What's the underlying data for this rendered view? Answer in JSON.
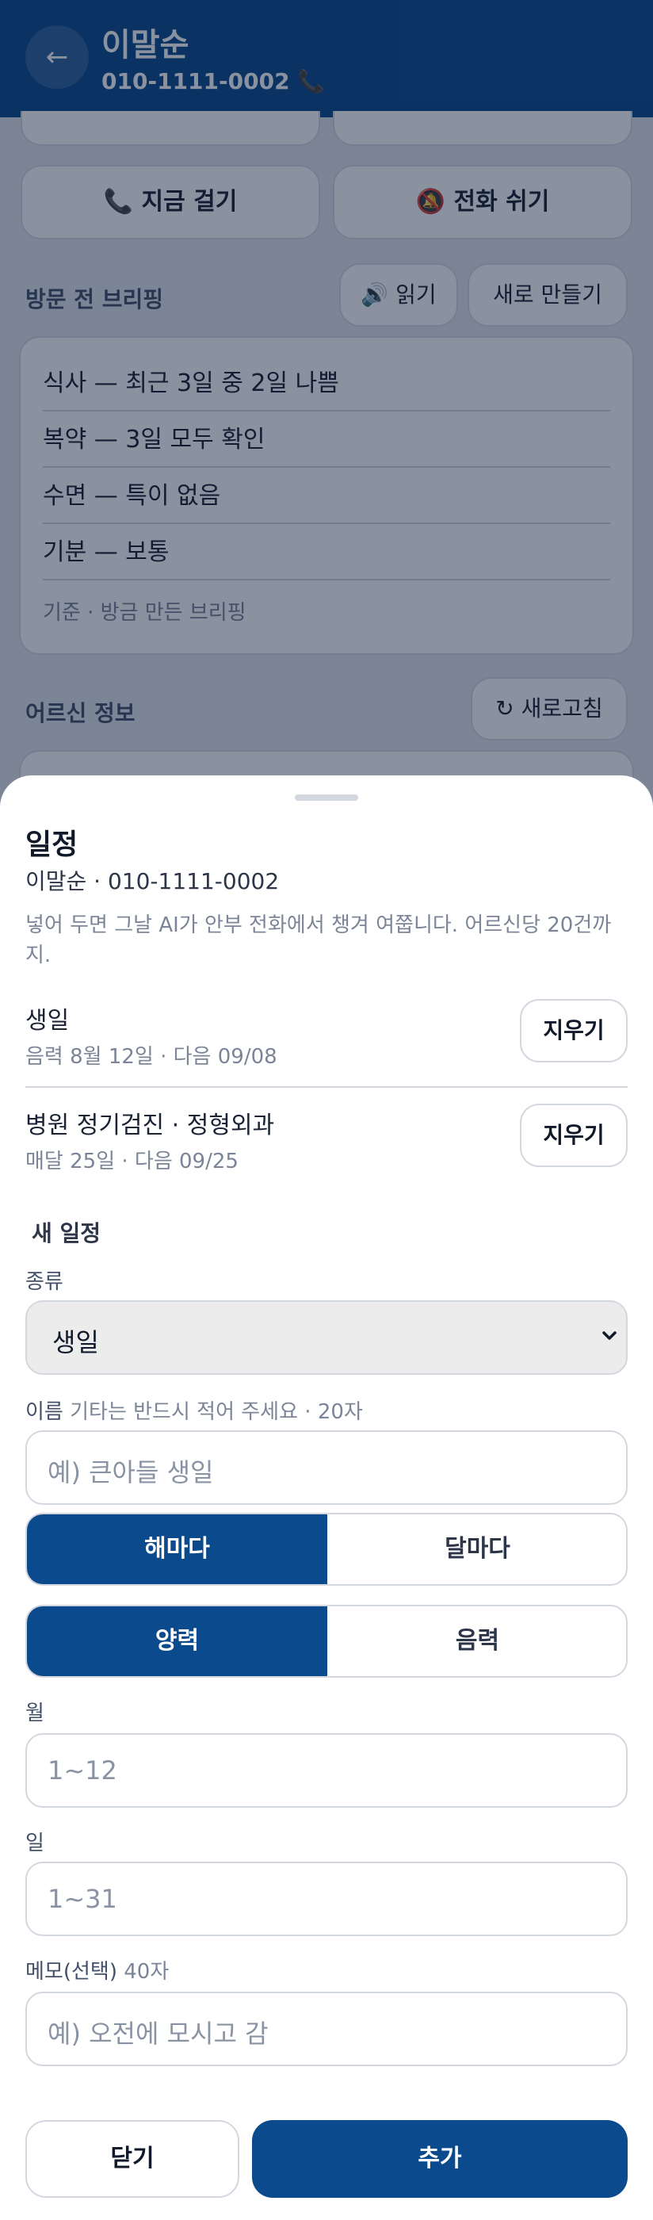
{
  "header": {
    "name": "이말순",
    "phone": "010-1111-0002 📞",
    "back_icon": "←"
  },
  "call_actions": {
    "call_now": "📞 지금 걸기",
    "rest_call": "🔕 전화 쉬기"
  },
  "briefing": {
    "title": "방문 전 브리핑",
    "read_label": "🔊 읽기",
    "regenerate_label": "새로 만들기",
    "rows": [
      "식사 — 최근 3일 중 2일 나쁨",
      "복약 — 3일 모두 확인",
      "수면 — 특이 없음",
      "기분 — 보통"
    ],
    "footer": "기준 · 방금 만든 브리핑"
  },
  "elder_info": {
    "title": "어르신 정보",
    "refresh_label": "↻ 새로고침"
  },
  "sheet": {
    "title": "일정",
    "subtitle": "이말순 · 010-1111-0002",
    "note": "넣어 두면 그날 AI가 안부 전화에서 챙겨 여쭙니다. 어르신당 20건까지.",
    "events": [
      {
        "title": "생일",
        "detail": "음력 8월 12일 · 다음 09/08",
        "clear_label": "지우기"
      },
      {
        "title": "병원 정기검진 · 정형외과",
        "detail": "매달 25일 · 다음 09/25",
        "clear_label": "지우기"
      }
    ],
    "new_section": "새 일정",
    "kind": {
      "label": "종류",
      "value": "생일"
    },
    "name_field": {
      "label": "이름",
      "hint": "기타는 반드시 적어 주세요 · 20자",
      "placeholder": "예) 큰아들 생일"
    },
    "repeat": {
      "options": [
        "해마다",
        "달마다"
      ],
      "selected": "해마다"
    },
    "calendar": {
      "options": [
        "양력",
        "음력"
      ],
      "selected": "양력"
    },
    "month_field": {
      "label": "월",
      "placeholder": "1~12"
    },
    "day_field": {
      "label": "일",
      "placeholder": "1~31"
    },
    "memo_field": {
      "label": "메모(선택)",
      "hint": "40자",
      "placeholder": "예) 오전에 모시고 감"
    },
    "close_label": "닫기",
    "add_label": "추가"
  },
  "colors": {
    "primary": "#0b4a8c",
    "overlay": "rgba(10,25,55,0.48)",
    "border": "#d3d7df",
    "muted_text": "#7b8597"
  },
  "icons": {
    "back": "arrow-left-icon",
    "caret": "chevron-down-icon",
    "phone": "phone-icon",
    "mute": "bell-off-icon",
    "speaker": "speaker-icon",
    "refresh": "refresh-icon"
  }
}
